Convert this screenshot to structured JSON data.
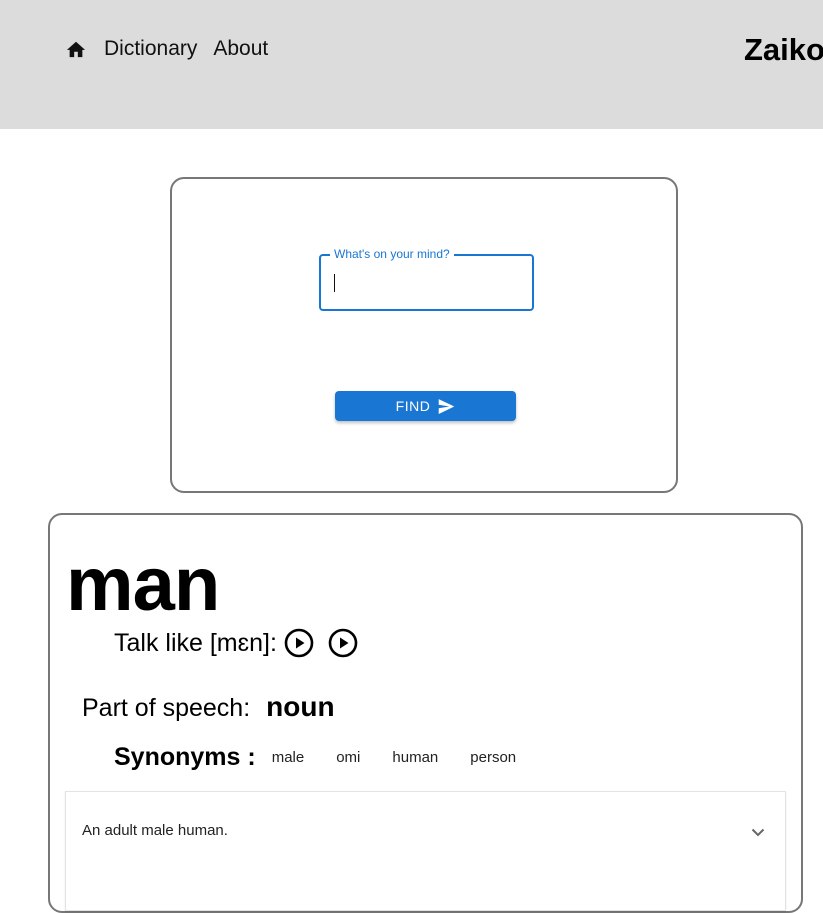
{
  "header": {
    "nav": [
      {
        "icon": "home-icon"
      },
      {
        "label": "Dictionary"
      },
      {
        "label": "About"
      }
    ],
    "brand": "Zaiko"
  },
  "search": {
    "legend": "What's on your mind?",
    "value": "",
    "button_label": "FIND",
    "button_icon": "send-icon",
    "accent": "#1976d2"
  },
  "result": {
    "word": "man",
    "talk_like_label": "Talk like [mɛn]:",
    "audio_icons": [
      "play-circle-icon",
      "play-circle-icon"
    ],
    "part_of_speech_label": "Part of speech:",
    "part_of_speech": "noun",
    "synonyms_label": "Synonyms :",
    "synonyms": [
      "male",
      "omi",
      "human",
      "person"
    ],
    "definitions": [
      {
        "text": "An adult male human.",
        "icon": "chevron-down-icon"
      }
    ]
  }
}
